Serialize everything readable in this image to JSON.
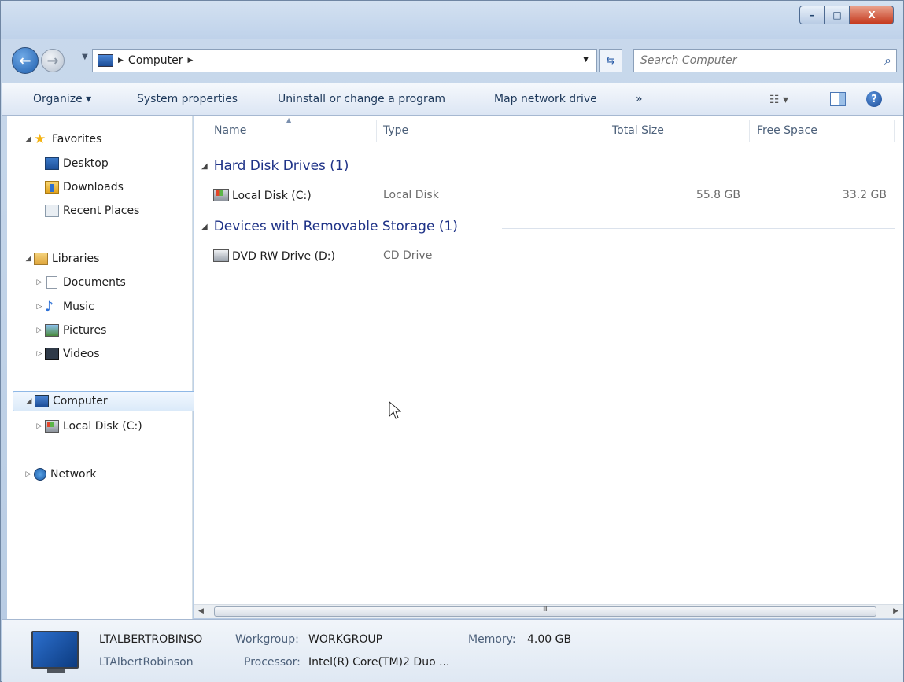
{
  "window": {
    "caption_min": "–",
    "caption_max": "□",
    "caption_close": "X"
  },
  "address": {
    "crumbs": [
      "Computer"
    ],
    "search_placeholder": "Search Computer"
  },
  "toolbar": {
    "organize": "Organize ▾",
    "system_properties": "System properties",
    "uninstall": "Uninstall or change a program",
    "map_drive": "Map network drive",
    "more": "»"
  },
  "nav": {
    "favorites": "Favorites",
    "desktop": "Desktop",
    "downloads": "Downloads",
    "recent_places": "Recent Places",
    "libraries": "Libraries",
    "documents": "Documents",
    "music": "Music",
    "pictures": "Pictures",
    "videos": "Videos",
    "computer": "Computer",
    "local_disk": "Local Disk (C:)",
    "network": "Network"
  },
  "columns": {
    "name": "Name",
    "type": "Type",
    "total_size": "Total Size",
    "free_space": "Free Space"
  },
  "groups": [
    {
      "title": "Hard Disk Drives (1)",
      "items": [
        {
          "name": "Local Disk (C:)",
          "type": "Local Disk",
          "total": "55.8 GB",
          "free": "33.2 GB"
        }
      ]
    },
    {
      "title": "Devices with Removable Storage (1)",
      "items": [
        {
          "name": "DVD RW Drive (D:)",
          "type": "CD Drive",
          "total": "",
          "free": ""
        }
      ]
    }
  ],
  "scrollbar": {
    "grip": "III"
  },
  "details": {
    "computer_name": "LTALBERTROBINSO",
    "user": "LTAlbertRobinson",
    "workgroup_label": "Workgroup:",
    "workgroup_value": "WORKGROUP",
    "memory_label": "Memory:",
    "memory_value": "4.00 GB",
    "processor_label": "Processor:",
    "processor_value": "Intel(R) Core(TM)2 Duo ..."
  }
}
